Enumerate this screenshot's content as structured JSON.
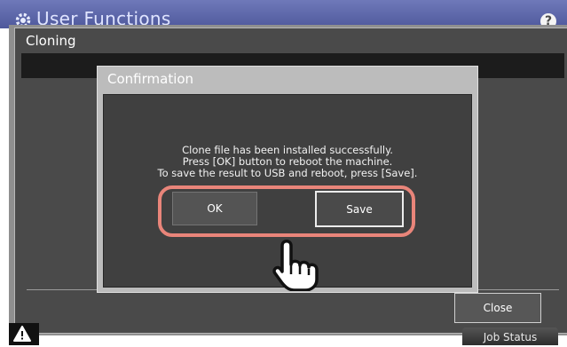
{
  "app": {
    "title": "User Functions",
    "help_label": "?"
  },
  "cloning": {
    "title": "Cloning",
    "close_label": "Close"
  },
  "dialog": {
    "title": "Confirmation",
    "message_lines": [
      "Clone file has been installed successfully.",
      "Press [OK] button to reboot the machine.",
      "To save the result to USB and reboot, press [Save]."
    ],
    "ok_label": "OK",
    "save_label": "Save"
  },
  "footer": {
    "job_status_label": "Job Status"
  },
  "colors": {
    "header_blue": "#5a64a8",
    "highlight": "#e9857a",
    "dialog_bg": "#404040"
  },
  "icons": {
    "header": "gear-icon",
    "help": "help-icon",
    "warning": "warning-icon",
    "pointer": "hand-pointer-icon"
  }
}
